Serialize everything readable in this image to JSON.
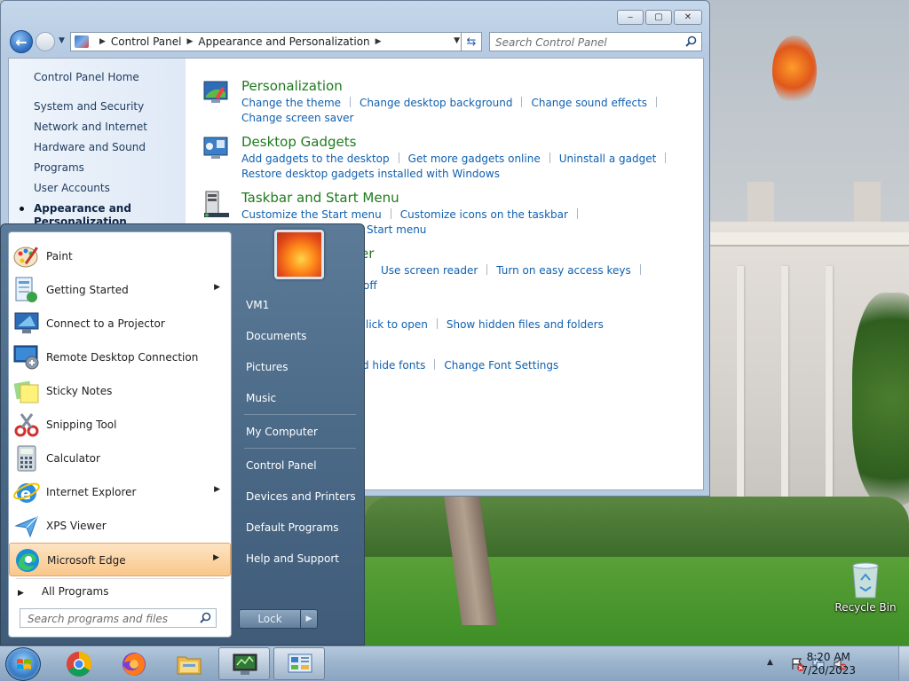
{
  "desktop": {
    "recycle_bin_label": "Recycle Bin"
  },
  "window": {
    "controls": {
      "minimize": "‒",
      "maximize": "▢",
      "close": "✕"
    },
    "address": {
      "crumbs": [
        "Control Panel",
        "Appearance and Personalization"
      ]
    },
    "search_placeholder": "Search Control Panel",
    "sidebar": {
      "home": "Control Panel Home",
      "categories": [
        "System and Security",
        "Network and Internet",
        "Hardware and Sound",
        "Programs",
        "User Accounts",
        "Appearance and Personalization"
      ]
    },
    "sections": [
      {
        "title": "Personalization",
        "links": [
          "Change the theme",
          "Change desktop background",
          "Change sound effects",
          "Change screen saver"
        ]
      },
      {
        "title": "Desktop Gadgets",
        "links": [
          "Add gadgets to the desktop",
          "Get more gadgets online",
          "Uninstall a gadget",
          "Restore desktop gadgets installed with Windows"
        ]
      },
      {
        "title": "Taskbar and Start Menu",
        "links": [
          "Customize the Start menu",
          "Customize icons on the taskbar",
          "Start menu"
        ]
      },
      {
        "title_fragment": "er",
        "links": [
          "Use screen reader",
          "Turn on easy access keys",
          "off"
        ]
      },
      {
        "links": [
          "lick to open",
          "Show hidden files and folders"
        ]
      },
      {
        "links": [
          "d hide fonts",
          "Change Font Settings"
        ]
      }
    ]
  },
  "start_menu": {
    "programs": [
      {
        "name": "Paint",
        "icon": "paint-icon",
        "has_submenu": false
      },
      {
        "name": "Getting Started",
        "icon": "getting-started-icon",
        "has_submenu": true
      },
      {
        "name": "Connect to a Projector",
        "icon": "projector-icon",
        "has_submenu": false
      },
      {
        "name": "Remote Desktop Connection",
        "icon": "remote-desktop-icon",
        "has_submenu": false
      },
      {
        "name": "Sticky Notes",
        "icon": "sticky-notes-icon",
        "has_submenu": false
      },
      {
        "name": "Snipping Tool",
        "icon": "snipping-tool-icon",
        "has_submenu": false
      },
      {
        "name": "Calculator",
        "icon": "calculator-icon",
        "has_submenu": false
      },
      {
        "name": "Internet Explorer",
        "icon": "internet-explorer-icon",
        "has_submenu": true
      },
      {
        "name": "XPS Viewer",
        "icon": "xps-viewer-icon",
        "has_submenu": false
      },
      {
        "name": "Microsoft Edge",
        "icon": "edge-icon",
        "has_submenu": true
      }
    ],
    "all_programs": "All Programs",
    "search_placeholder": "Search programs and files",
    "right_links": [
      "VM1",
      "Documents",
      "Pictures",
      "Music",
      "My Computer",
      "Control Panel",
      "Devices and Printers",
      "Default Programs",
      "Help and Support"
    ],
    "lock_label": "Lock",
    "submenu_arrow": "▶"
  },
  "taskbar": {
    "pinned": [
      "start-orb",
      "chrome-icon",
      "firefox-icon",
      "explorer-folder-icon",
      "control-panel-task-icon",
      "monitor-task-icon"
    ],
    "clock_time": "8:20 AM",
    "clock_date": "7/20/2023",
    "tray_up_arrow": "▲"
  },
  "colors": {
    "link_blue": "#1060b0",
    "section_green": "#1f7a1f",
    "taskbar": "#9bb3cc",
    "start_menu_right": "#4b6a88",
    "highlight_orange": "#f9c78a"
  }
}
